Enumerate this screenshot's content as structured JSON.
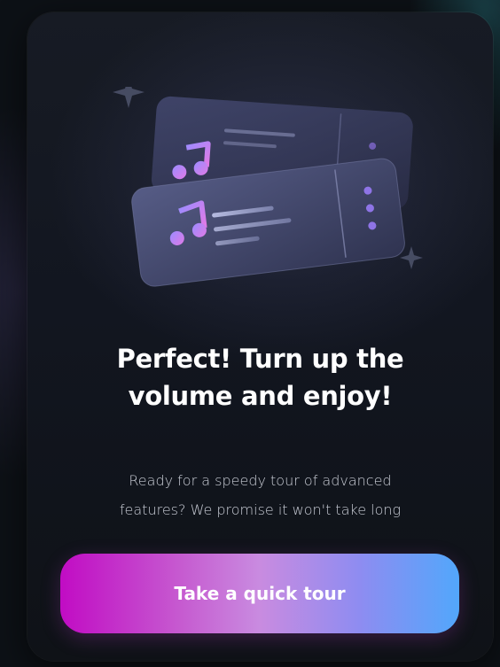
{
  "card": {
    "title_line1": "Perfect! Turn up the",
    "title_line2": "volume and enjoy!",
    "subtitle_line1": "Ready for a speedy tour of advanced",
    "subtitle_line2": "features? We promise it won't take long",
    "cta_label": "Take a quick tour"
  },
  "illustration": {
    "icons": [
      "sparkle-icon",
      "ticket-icon",
      "music-note-icon"
    ]
  },
  "colors": {
    "background": "#0d1116",
    "card": "#141821",
    "gradient_start": "#c10cc4",
    "gradient_mid": "#c98be0",
    "gradient_end": "#52a7fb"
  }
}
